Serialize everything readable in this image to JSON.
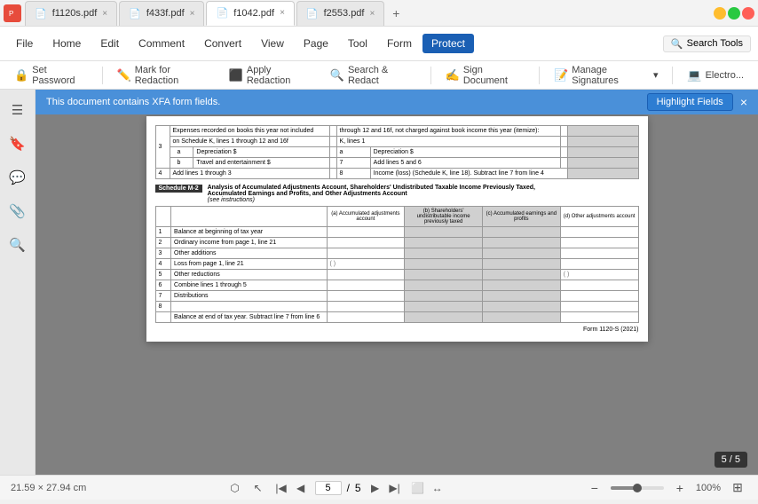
{
  "titlebar": {
    "tabs": [
      {
        "label": "f1120s.pdf",
        "active": false
      },
      {
        "label": "f433f.pdf",
        "active": false
      },
      {
        "label": "f1042.pdf",
        "active": true
      },
      {
        "label": "f2553.pdf",
        "active": false
      }
    ]
  },
  "ribbon": {
    "nav_items": [
      {
        "label": "File",
        "active": false
      },
      {
        "label": "Home",
        "active": false
      },
      {
        "label": "Edit",
        "active": false
      },
      {
        "label": "Comment",
        "active": false
      },
      {
        "label": "Convert",
        "active": false
      },
      {
        "label": "View",
        "active": false
      },
      {
        "label": "Page",
        "active": false
      },
      {
        "label": "Tool",
        "active": false
      },
      {
        "label": "Form",
        "active": false
      },
      {
        "label": "Protect",
        "active": true
      }
    ],
    "search_placeholder": "Search Tools",
    "toolbar2": {
      "set_password": "Set Password",
      "mark_for_redaction": "Mark for Redaction",
      "apply_redaction": "Apply Redaction",
      "search_redact": "Search & Redact",
      "sign_document": "Sign Document",
      "manage_signatures": "Manage Signatures",
      "electronic": "Electro..."
    }
  },
  "notification": {
    "text": "This document contains XFA form fields.",
    "button": "Highlight Fields",
    "close": "×"
  },
  "pdf": {
    "schedule_m2": {
      "badge": "Schedule M-2",
      "title": "Analysis of Accumulated Adjustments Account, Shareholders' Undistributed Taxable Income Previously Taxed,",
      "title2": "Accumulated Earnings and Profits, and Other Adjustments Account",
      "instructions": "(see instructions)",
      "columns": [
        "(a) Accumulated adjustments account",
        "(b) Shareholders' undistributable income previously taxed",
        "(c) Accumulated earnings and profits",
        "(d) Other adjustments account"
      ],
      "rows": [
        {
          "num": "1",
          "label": "Balance at beginning of tax year"
        },
        {
          "num": "2",
          "label": "Ordinary income from page 1, line 21"
        },
        {
          "num": "3",
          "label": "Other additions"
        },
        {
          "num": "4",
          "label": "Loss from page 1, line 21"
        },
        {
          "num": "5",
          "label": "Other reductions"
        },
        {
          "num": "6",
          "label": "Combine lines 1 through 5"
        },
        {
          "num": "7",
          "label": "Distributions"
        },
        {
          "num": "8",
          "label": ""
        },
        {
          "num": "",
          "label": "Balance at end of tax year. Subtract line 7 from line 6"
        }
      ],
      "form_label": "Form 1120-S (2021)"
    }
  },
  "status": {
    "dimensions": "21.59 × 27.94 cm",
    "page_current": "5",
    "page_total": "5",
    "page_badge": "5 / 5",
    "zoom": "100%"
  },
  "sidebar": {
    "icons": [
      "☰",
      "🔖",
      "💬",
      "📎",
      "🔍"
    ]
  }
}
